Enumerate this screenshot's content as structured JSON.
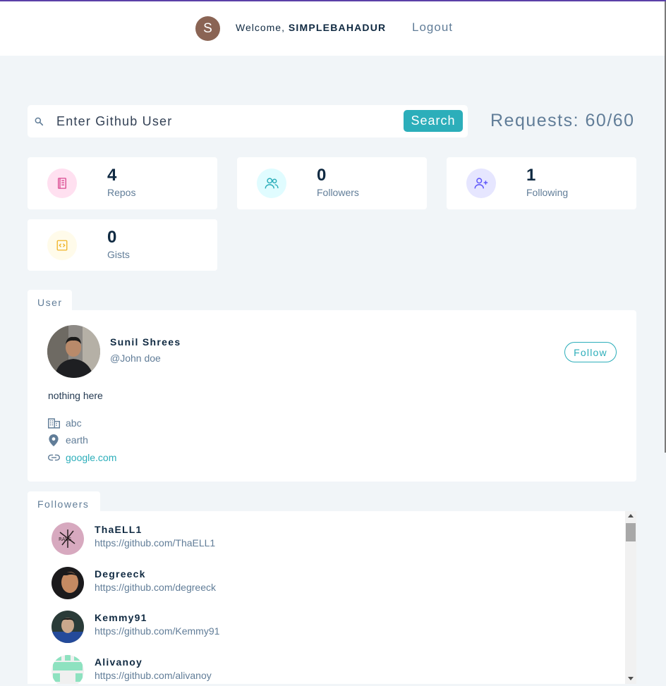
{
  "header": {
    "avatar_letter": "S",
    "welcome_text": "Welcome, ",
    "username": "SIMPLEBAHADUR",
    "logout_label": "Logout"
  },
  "search": {
    "placeholder": "Enter Github User",
    "button_label": "Search",
    "requests_label": "Requests: 60/60"
  },
  "stats": [
    {
      "value": "4",
      "label": "Repos",
      "icon": "book-icon",
      "color": "#da4a91",
      "bg": "#ffe0f0"
    },
    {
      "value": "0",
      "label": "Followers",
      "icon": "users-icon",
      "color": "#2caeba",
      "bg": "#e0fcff"
    },
    {
      "value": "1",
      "label": "Following",
      "icon": "user-plus-icon",
      "color": "#5d55fa",
      "bg": "#e6e6ff"
    },
    {
      "value": "0",
      "label": "Gists",
      "icon": "code-icon",
      "color": "#f0b429",
      "bg": "#fffbea"
    }
  ],
  "user": {
    "tab_label": "User",
    "name": "Sunil Shrees",
    "handle": "@John doe",
    "follow_label": "Follow",
    "bio": "nothing here",
    "company": "abc",
    "location": "earth",
    "blog": "google.com"
  },
  "followers": {
    "tab_label": "Followers",
    "items": [
      {
        "login": "ThaELL1",
        "url": "https://github.com/ThaELL1"
      },
      {
        "login": "Degreeck",
        "url": "https://github.com/degreeck"
      },
      {
        "login": "Kemmy91",
        "url": "https://github.com/Kemmy91"
      },
      {
        "login": "Alivanoy",
        "url": "https://github.com/alivanoy"
      }
    ]
  },
  "colors": {
    "accent": "#2caeba",
    "topline": "#5b3fa8",
    "text_dark": "#102a42",
    "text_muted": "#617d98"
  }
}
